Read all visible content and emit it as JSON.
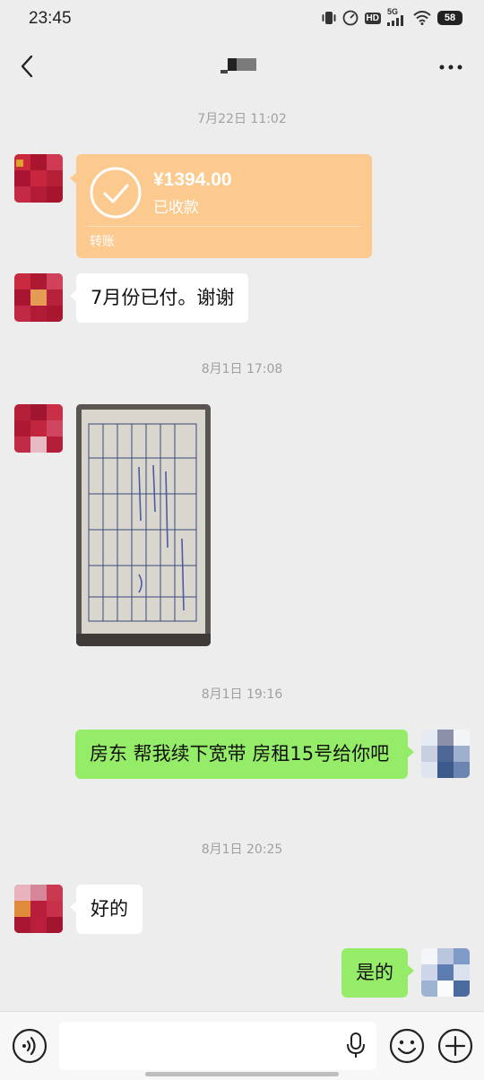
{
  "status_bar": {
    "time": "23:45",
    "network_label": "HD",
    "signal_label": "5G",
    "battery": "58"
  },
  "nav": {
    "title": "",
    "back_icon": "chevron-left-icon",
    "more_icon": "more-dots-icon"
  },
  "messages": [
    {
      "type": "time",
      "text": "7月22日 11:02"
    },
    {
      "type": "transfer",
      "side": "left",
      "amount": "¥1394.00",
      "status": "已收款",
      "label": "转账",
      "color": "#fcc98f"
    },
    {
      "type": "text",
      "side": "left",
      "text": "7月份已付。谢谢"
    },
    {
      "type": "time",
      "text": "8月1日 17:08"
    },
    {
      "type": "image",
      "side": "left",
      "description_icon": "photo-receipt"
    },
    {
      "type": "time",
      "text": "8月1日 19:16"
    },
    {
      "type": "text",
      "side": "right",
      "text": "房东 帮我续下宽带 房租15号给你吧"
    },
    {
      "type": "time",
      "text": "8月1日 20:25"
    },
    {
      "type": "text",
      "side": "left",
      "text": "好的"
    },
    {
      "type": "text",
      "side": "right",
      "text": "是的"
    }
  ],
  "input_bar": {
    "value": "",
    "voice_icon": "voice-icon",
    "mic_icon": "microphone-icon",
    "emoji_icon": "emoji-icon",
    "plus_icon": "plus-icon"
  },
  "colors": {
    "background": "#ededed",
    "bubble_self": "#95ec69",
    "bubble_other": "#ffffff",
    "transfer_card": "#fcc98f"
  }
}
